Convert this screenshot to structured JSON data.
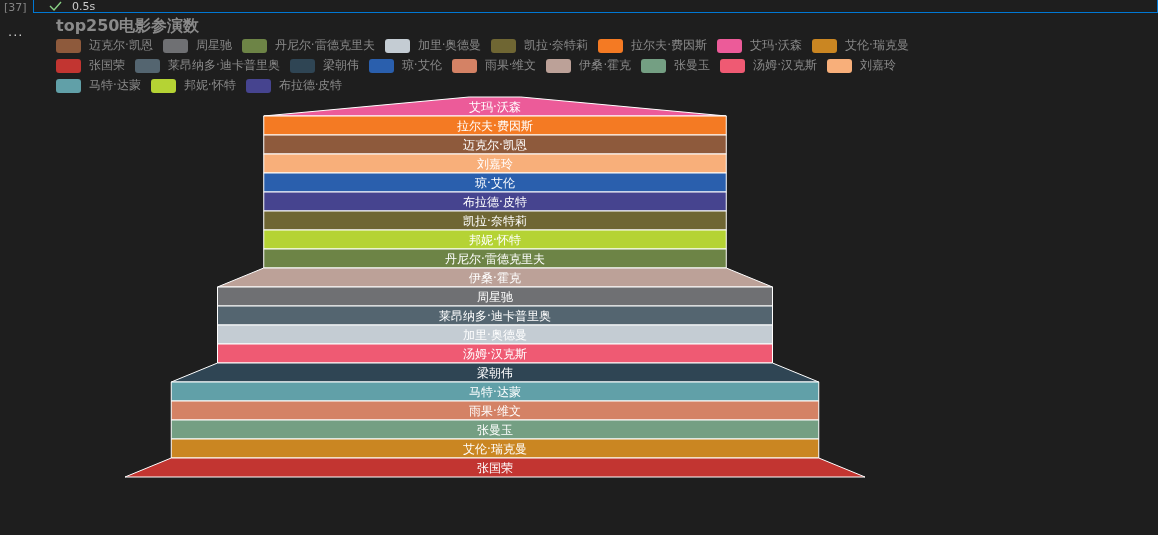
{
  "cell": {
    "number": "[37]",
    "duration": "0.5s",
    "more": "..."
  },
  "chart": {
    "title": "top250电影参演数",
    "legend": [
      {
        "label": "迈克尔·凯恩",
        "color": "#8e5a3c"
      },
      {
        "label": "周星驰",
        "color": "#6f7073"
      },
      {
        "label": "丹尼尔·雷德克里夫",
        "color": "#6d8446"
      },
      {
        "label": "加里·奥德曼",
        "color": "#c4ccd3"
      },
      {
        "label": "凯拉·奈特莉",
        "color": "#6f6633"
      },
      {
        "label": "拉尔夫·费因斯",
        "color": "#f47a23"
      },
      {
        "label": "艾玛·沃森",
        "color": "#ec5b99"
      },
      {
        "label": "艾伦·瑞克曼",
        "color": "#ca8622"
      },
      {
        "label": "张国荣",
        "color": "#c23531"
      },
      {
        "label": "莱昂纳多·迪卡普里奥",
        "color": "#546570"
      },
      {
        "label": "梁朝伟",
        "color": "#2f4554"
      },
      {
        "label": "琼·艾伦",
        "color": "#2a5fad"
      },
      {
        "label": "雨果·维文",
        "color": "#d48265"
      },
      {
        "label": "伊桑·霍克",
        "color": "#bca198"
      },
      {
        "label": "张曼玉",
        "color": "#749f83"
      },
      {
        "label": "汤姆·汉克斯",
        "color": "#ef5a73"
      },
      {
        "label": "刘嘉玲",
        "color": "#f8af7a"
      },
      {
        "label": "马特·达蒙",
        "color": "#61a0a8"
      },
      {
        "label": "邦妮·怀特",
        "color": "#b5d334"
      },
      {
        "label": "布拉德·皮特",
        "color": "#46448f"
      }
    ],
    "segments": [
      {
        "label": "艾玛·沃森",
        "color": "#ec5b99",
        "kind": "tip"
      },
      {
        "label": "拉尔夫·费因斯",
        "color": "#f47a23",
        "kind": "band"
      },
      {
        "label": "迈克尔·凯恩",
        "color": "#8e5a3c",
        "kind": "band"
      },
      {
        "label": "刘嘉玲",
        "color": "#f8af7a",
        "kind": "band"
      },
      {
        "label": "琼·艾伦",
        "color": "#2a5fad",
        "kind": "band"
      },
      {
        "label": "布拉德·皮特",
        "color": "#46448f",
        "kind": "band"
      },
      {
        "label": "凯拉·奈特莉",
        "color": "#6f6633",
        "kind": "band"
      },
      {
        "label": "邦妮·怀特",
        "color": "#b5d334",
        "kind": "band"
      },
      {
        "label": "丹尼尔·雷德克里夫",
        "color": "#6d8446",
        "kind": "band"
      },
      {
        "label": "伊桑·霍克",
        "color": "#bca198",
        "kind": "step"
      },
      {
        "label": "周星驰",
        "color": "#6f7073",
        "kind": "band"
      },
      {
        "label": "莱昂纳多·迪卡普里奥",
        "color": "#546570",
        "kind": "band"
      },
      {
        "label": "加里·奥德曼",
        "color": "#c4ccd3",
        "kind": "band"
      },
      {
        "label": "汤姆·汉克斯",
        "color": "#ef5a73",
        "kind": "band"
      },
      {
        "label": "梁朝伟",
        "color": "#2f4554",
        "kind": "step"
      },
      {
        "label": "马特·达蒙",
        "color": "#61a0a8",
        "kind": "band"
      },
      {
        "label": "雨果·维文",
        "color": "#d48265",
        "kind": "band"
      },
      {
        "label": "张曼玉",
        "color": "#749f83",
        "kind": "band"
      },
      {
        "label": "艾伦·瑞克曼",
        "color": "#ca8622",
        "kind": "band"
      },
      {
        "label": "张国荣",
        "color": "#c23531",
        "kind": "step"
      }
    ]
  }
}
